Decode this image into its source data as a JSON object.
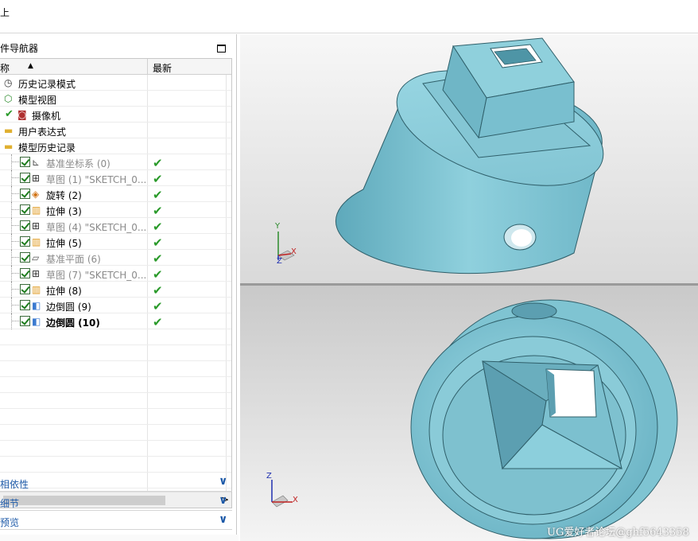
{
  "topbar": {
    "text": "上"
  },
  "navigator": {
    "title": "件导航器",
    "columns": {
      "name": "称",
      "latest": "最新"
    },
    "rows": [
      {
        "label": "历史记录模式",
        "icon": "clock-icon",
        "indent": 5,
        "style": "normal",
        "check": false,
        "latest": ""
      },
      {
        "label": "模型视图",
        "icon": "model-view-icon",
        "indent": 5,
        "style": "normal",
        "check": false,
        "latest": ""
      },
      {
        "label": "摄像机",
        "icon": "camera-icon",
        "indent": 22,
        "style": "normal",
        "check": false,
        "latest": ""
      },
      {
        "label": "用户表达式",
        "icon": "folder-icon",
        "indent": 5,
        "style": "normal",
        "check": false,
        "latest": ""
      },
      {
        "label": "模型历史记录",
        "icon": "folder-open-icon",
        "indent": 5,
        "style": "normal",
        "check": false,
        "latest": ""
      },
      {
        "label": "基准坐标系 (0)",
        "icon": "datum-csys-icon",
        "indent": 40,
        "style": "grey",
        "check": true,
        "latest": "✔"
      },
      {
        "label": "草图 (1) \"SKETCH_0...",
        "icon": "sketch-icon",
        "indent": 40,
        "style": "grey",
        "check": true,
        "latest": "✔"
      },
      {
        "label": "旋转 (2)",
        "icon": "revolve-icon",
        "indent": 40,
        "style": "normal",
        "check": true,
        "latest": "✔"
      },
      {
        "label": "拉伸 (3)",
        "icon": "extrude-icon",
        "indent": 40,
        "style": "normal",
        "check": true,
        "latest": "✔"
      },
      {
        "label": "草图 (4) \"SKETCH_0...",
        "icon": "sketch-icon",
        "indent": 40,
        "style": "grey",
        "check": true,
        "latest": "✔"
      },
      {
        "label": "拉伸 (5)",
        "icon": "extrude-icon",
        "indent": 40,
        "style": "normal",
        "check": true,
        "latest": "✔"
      },
      {
        "label": "基准平面 (6)",
        "icon": "datum-plane-icon",
        "indent": 40,
        "style": "grey",
        "check": true,
        "latest": "✔"
      },
      {
        "label": "草图 (7) \"SKETCH_0...",
        "icon": "sketch-icon",
        "indent": 40,
        "style": "grey",
        "check": true,
        "latest": "✔"
      },
      {
        "label": "拉伸 (8)",
        "icon": "extrude-icon",
        "indent": 40,
        "style": "normal",
        "check": true,
        "latest": "✔"
      },
      {
        "label": "边倒圆 (9)",
        "icon": "edge-blend-icon",
        "indent": 40,
        "style": "normal",
        "check": true,
        "latest": "✔"
      },
      {
        "label": "边倒圆 (10)",
        "icon": "edge-blend-icon",
        "indent": 40,
        "style": "bold",
        "check": true,
        "latest": "✔"
      }
    ],
    "panels": [
      {
        "label": "相依性"
      },
      {
        "label": "细节"
      },
      {
        "label": "预览"
      }
    ],
    "scroll_arrow": ">",
    "panel_chevron": "∨"
  },
  "viewports": {
    "top": {
      "triad": {
        "x": "X",
        "y": "Y",
        "z": "Z"
      }
    },
    "bottom": {
      "triad": {
        "x": "X",
        "z": "Z"
      }
    }
  },
  "watermark": "UG爱好者论坛@ghf5643358",
  "colors": {
    "part": "#86c9d6",
    "part_dark": "#5aa7b8",
    "accent": "#1e5aa8",
    "check": "#2a9a2a"
  }
}
